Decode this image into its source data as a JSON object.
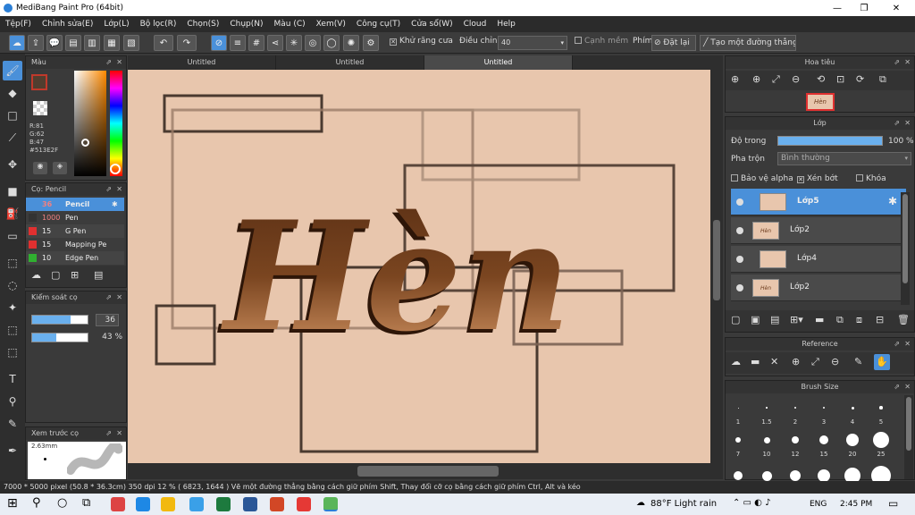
{
  "window": {
    "title": "MediBang Paint Pro (64bit)",
    "min": "—",
    "max": "❐",
    "close": "✕"
  },
  "menu": [
    "Tệp(F)",
    "Chỉnh sửa(E)",
    "Lớp(L)",
    "Bộ lọc(R)",
    "Chọn(S)",
    "Chụp(N)",
    "Màu (C)",
    "Xem(V)",
    "Công cụ(T)",
    "Cửa sổ(W)",
    "Cloud",
    "Help"
  ],
  "toolbar": {
    "antialias_label": "Khử răng cưa",
    "adjust_label": "Điều chỉnh",
    "adjust_value": "40",
    "soft_edge_label": "Cạnh mềm",
    "key_label": "Phím",
    "reset_label": "Đặt lại",
    "straight_line_label": "Tạo một đường thẳng"
  },
  "color_panel": {
    "title": "Màu",
    "r": "R:81",
    "g": "G:62",
    "b": "B:47",
    "hex": "#513E2F",
    "fg_color": "#513E2F"
  },
  "brush_panel": {
    "title": "Cọ: Pencil",
    "items": [
      {
        "size": "36",
        "name": "Pencil",
        "color": "#4a90d9"
      },
      {
        "size": "1000",
        "name": "Pen",
        "color": "#333333"
      },
      {
        "size": "15",
        "name": "G Pen",
        "color": "#e03030"
      },
      {
        "size": "15",
        "name": "Mapping Pe",
        "color": "#e03030"
      },
      {
        "size": "10",
        "name": "Edge Pen",
        "color": "#30b030"
      }
    ]
  },
  "brush_control": {
    "title": "Kiểm soát cọ",
    "size_value": "36",
    "opacity_value": "43 %",
    "size_fraction": 0.7,
    "opacity_fraction": 0.43
  },
  "preview": {
    "title": "Xem trước cọ",
    "size": "2.63mm"
  },
  "tabs": [
    "Untitled",
    "Untitled",
    "Untitled"
  ],
  "artwork": {
    "text": "Hèn"
  },
  "navigator": {
    "title": "Hoa tiêu",
    "thumb_text": "Hèn"
  },
  "layer_panel": {
    "title": "Lớp",
    "opacity_label": "Độ trong",
    "opacity_value": "100 %",
    "blend_label": "Pha trộn",
    "blend_value": "Bình thường",
    "protect_alpha": "Bảo vệ alpha",
    "clipping": "Xén bớt",
    "lock": "Khóa",
    "layers": [
      {
        "name": "Lớp5",
        "thumb": "",
        "selected": true
      },
      {
        "name": "Lớp2",
        "thumb": "Hèn",
        "selected": false
      },
      {
        "name": "Lớp4",
        "thumb": "",
        "selected": false
      },
      {
        "name": "Lớp2",
        "thumb": "Hèn",
        "selected": false
      }
    ]
  },
  "reference": {
    "title": "Reference"
  },
  "brush_size": {
    "title": "Brush Size",
    "row1": [
      "1",
      "1.5",
      "2",
      "3",
      "4",
      "5"
    ],
    "row2": [
      "7",
      "10",
      "12",
      "15",
      "20",
      "25"
    ]
  },
  "status": {
    "text": "7000 * 5000 pixel   (50.8 * 36.3cm)    350 dpi    12 %    ( 6823, 1644 )   Vẽ một đường thẳng bằng cách giữ phím Shift, Thay đổi cỡ cọ bằng cách giữ phím Ctrl, Alt và kéo"
  },
  "taskbar": {
    "weather": "88°F  Light rain",
    "lang": "ENG",
    "time": "2:45 PM"
  }
}
